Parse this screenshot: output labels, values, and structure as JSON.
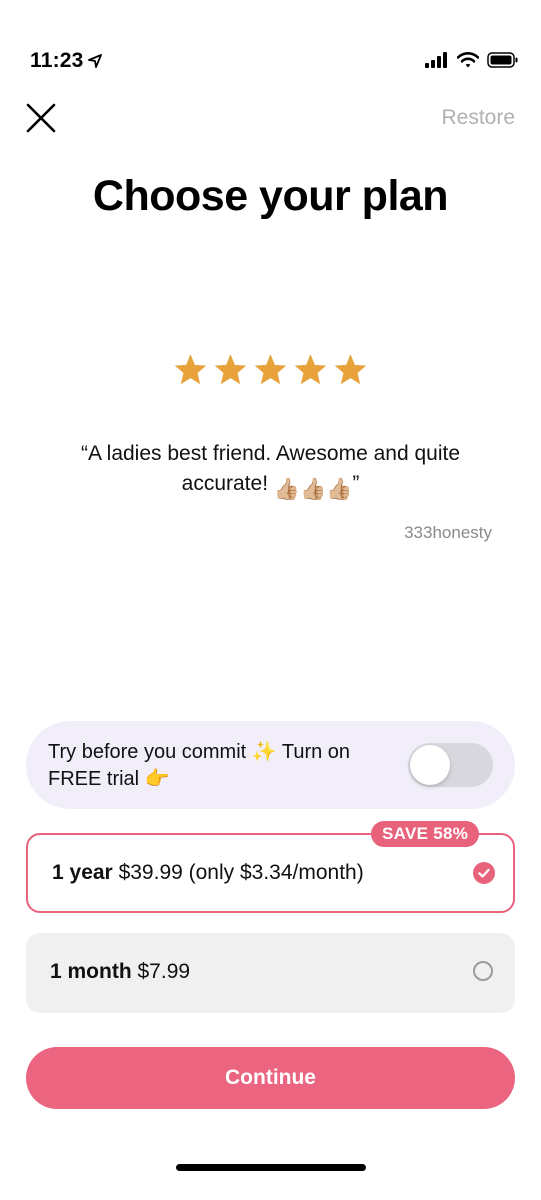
{
  "status_bar": {
    "time": "11:23",
    "icons": [
      "location-arrow-icon",
      "signal-icon",
      "wifi-icon",
      "battery-icon"
    ]
  },
  "header": {
    "restore_label": "Restore",
    "close_icon": "close-icon"
  },
  "title": "Choose your plan",
  "review": {
    "rating": 5,
    "max_rating": 5,
    "quote_text": "“A ladies best friend. Awesome and quite accurate! ",
    "quote_emoji": "👍🏼👍🏼👍🏼",
    "quote_end": "”",
    "reviewer": "333honesty",
    "star_color": "#e8a23b"
  },
  "trial": {
    "text_part1": "Try before you commit ",
    "sparkle": "✨",
    "text_part2": " Turn on FREE trial ",
    "point": "👉",
    "toggle_on": false
  },
  "plans": [
    {
      "name": "1 year",
      "price": " $39.99 (only $3.34/month)",
      "badge": "SAVE 58%",
      "selected": true
    },
    {
      "name": "1 month",
      "price": " $7.99",
      "selected": false
    }
  ],
  "continue_label": "Continue",
  "colors": {
    "accent": "#eb6580",
    "trial_bg": "#f1eefa",
    "plan_unselected_bg": "#f0f0f0",
    "muted_text": "#b1b1b1"
  }
}
